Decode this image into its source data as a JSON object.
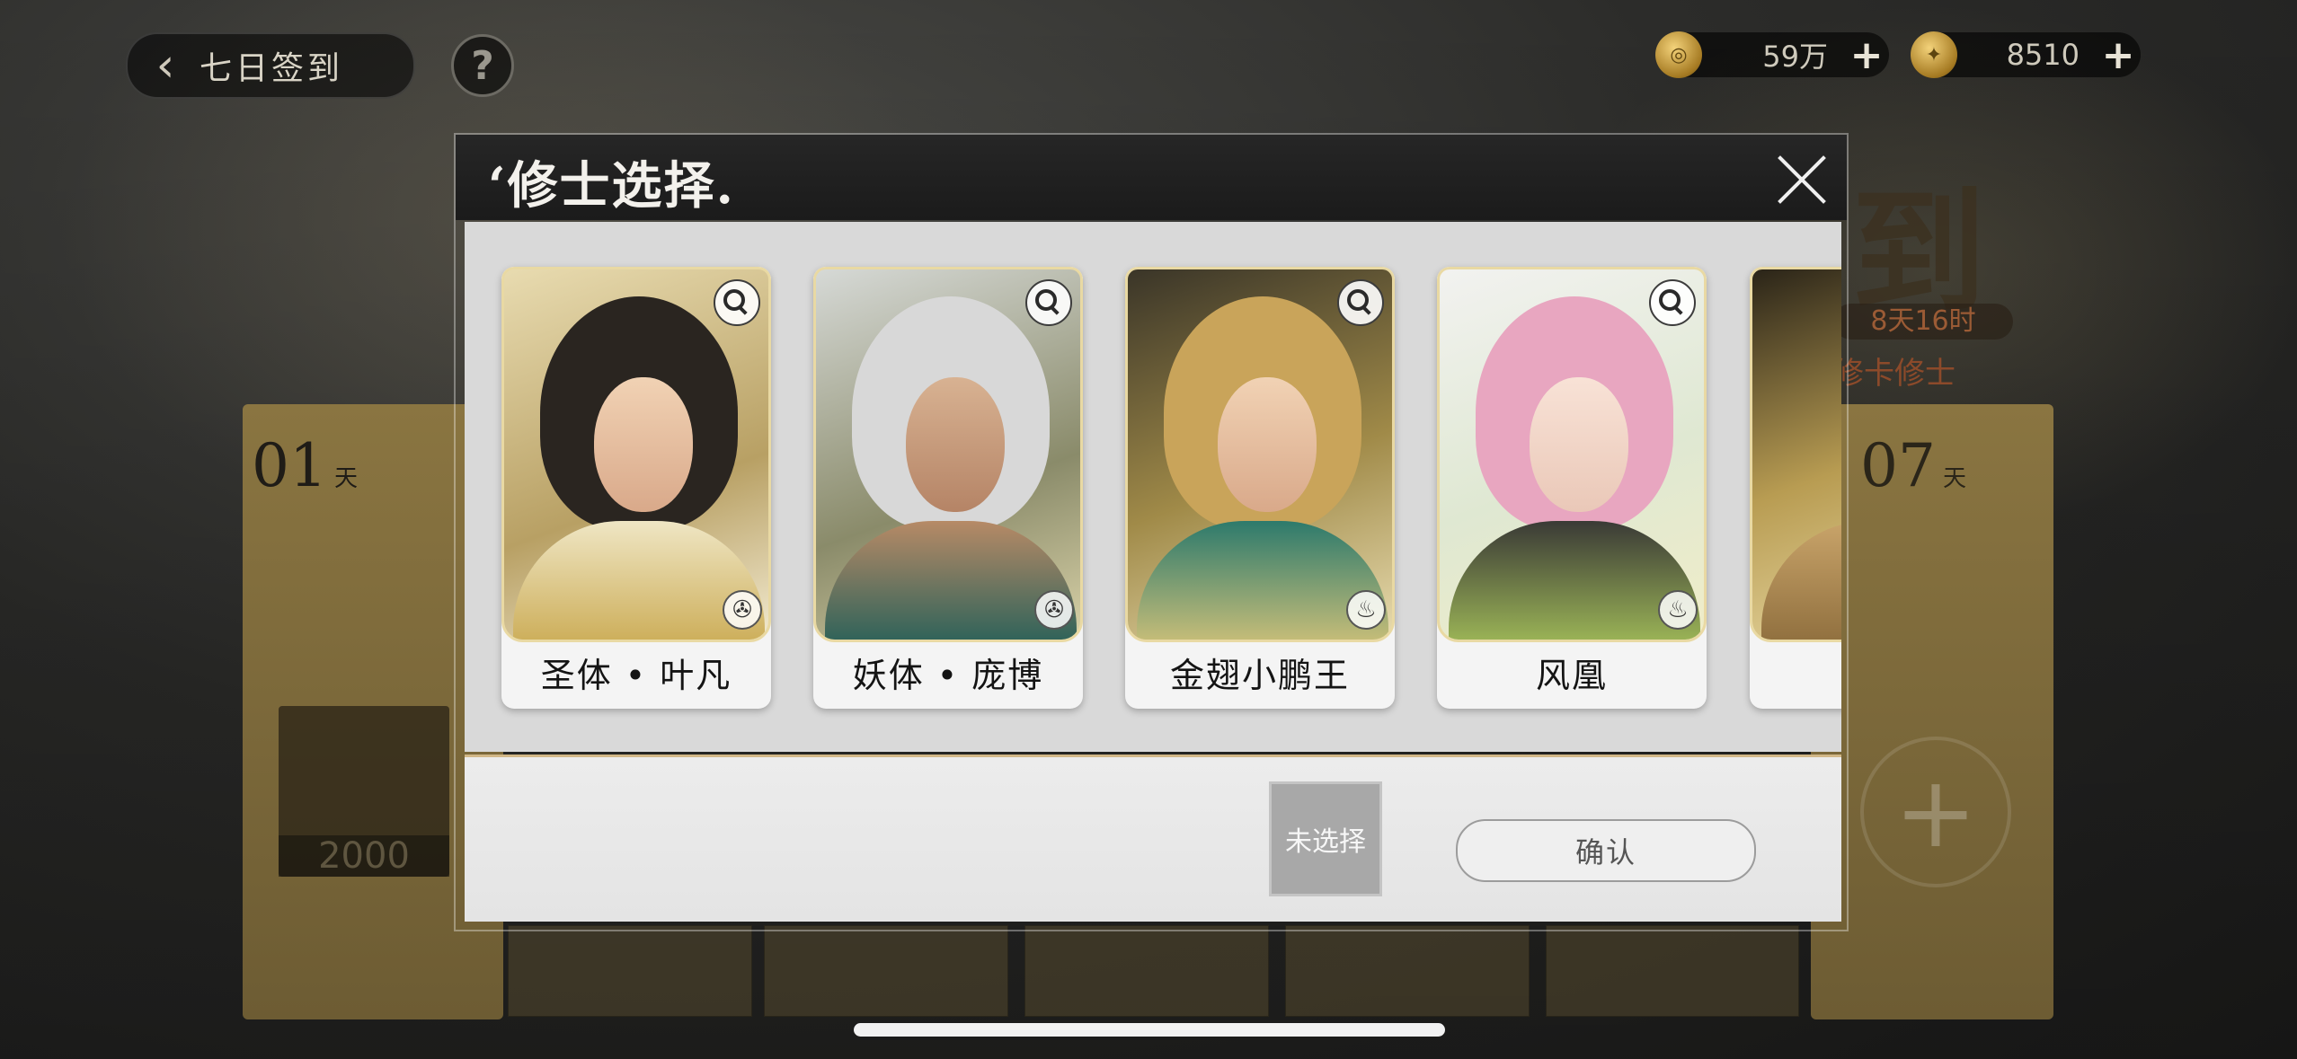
{
  "header": {
    "back_label": "七日签到",
    "help_symbol": "?",
    "currencies": [
      {
        "value": "59万",
        "icon": "coin-icon",
        "plus": "+"
      },
      {
        "value": "8510",
        "icon": "gem-icon",
        "plus": "+"
      }
    ]
  },
  "background": {
    "title_glyph": "到",
    "timer": "8天16时",
    "subtitle": "修卡修士",
    "day_first": {
      "num": "01",
      "unit": "天"
    },
    "day_last": {
      "num": "07",
      "unit": "天"
    },
    "reward_value": "2000",
    "add_symbol": "+"
  },
  "dialog": {
    "title": "‘修士选择.",
    "cards": [
      {
        "name": "圣体 • 叶凡",
        "element_icon": "swirl-element-icon",
        "element_glyph": "✇"
      },
      {
        "name": "妖体 • 庞博",
        "element_icon": "swirl-element-icon",
        "element_glyph": "✇"
      },
      {
        "name": "金翅小鹏王",
        "element_icon": "flame-element-icon",
        "element_glyph": "♨"
      },
      {
        "name": "风凰",
        "element_icon": "flame-element-icon",
        "element_glyph": "♨"
      },
      {
        "name": "",
        "element_icon": "",
        "element_glyph": ""
      }
    ],
    "unselected_label": "未选择",
    "confirm_label": "确认"
  },
  "colors": {
    "accent_gold": "#d1b787",
    "card_bg": "#f4f4f4",
    "dialog_header": "#1b1b1b"
  }
}
